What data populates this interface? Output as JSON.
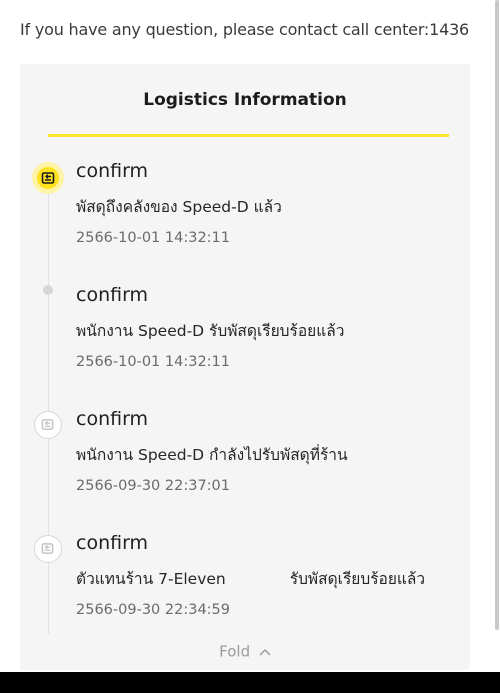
{
  "notice": {
    "text": "If you have any question, please contact call center:1436"
  },
  "logistics": {
    "title": "Logistics Information",
    "events": [
      {
        "status": "confirm",
        "description": "พัสดุถึงคลังของ Speed-D แล้ว",
        "time": "2566-10-01 14:32:11",
        "marker": "active-package-icon"
      },
      {
        "status": "confirm",
        "description": "พนักงาน Speed-D รับพัสดุเรียบร้อยแล้ว",
        "time": "2566-10-01 14:32:11",
        "marker": "dot"
      },
      {
        "status": "confirm",
        "description": "พนักงาน Speed-D กำลังไปรับพัสดุที่ร้าน",
        "time": "2566-09-30 22:37:01",
        "marker": "package-icon"
      },
      {
        "status": "confirm",
        "description_part1": "ตัวแทนร้าน 7-Eleven",
        "description_part2": "รับพัสดุเรียบร้อยแล้ว",
        "time": "2566-09-30 22:34:59",
        "marker": "package-icon"
      }
    ],
    "fold_label": "Fold"
  },
  "colors": {
    "accent": "#ffe21f",
    "card_background": "#f5f5f5",
    "muted_text": "#6b6b6b"
  }
}
